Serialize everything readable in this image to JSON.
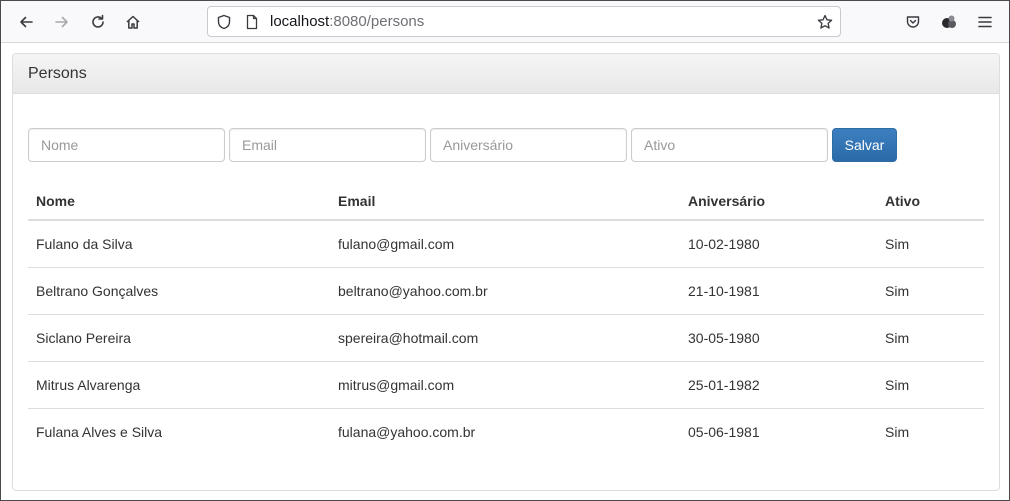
{
  "browser": {
    "url_host": "localhost",
    "url_rest": ":8080/persons",
    "icons": [
      "back-arrow-icon",
      "forward-arrow-icon",
      "reload-icon",
      "home-icon",
      "shield-icon",
      "page-icon",
      "bookmark-star-icon",
      "pocket-icon",
      "extension-icon",
      "menu-icon"
    ]
  },
  "panel": {
    "title": "Persons"
  },
  "form": {
    "nome_placeholder": "Nome",
    "email_placeholder": "Email",
    "aniversario_placeholder": "Aniversário",
    "ativo_placeholder": "Ativo",
    "save_label": "Salvar"
  },
  "table": {
    "headers": [
      "Nome",
      "Email",
      "Aniversário",
      "Ativo"
    ],
    "rows": [
      [
        "Fulano da Silva",
        "fulano@gmail.com",
        "10-02-1980",
        "Sim"
      ],
      [
        "Beltrano Gonçalves",
        "beltrano@yahoo.com.br",
        "21-10-1981",
        "Sim"
      ],
      [
        "Siclano Pereira",
        "spereira@hotmail.com",
        "30-05-1980",
        "Sim"
      ],
      [
        "Mitrus Alvarenga",
        "mitrus@gmail.com",
        "25-01-1982",
        "Sim"
      ],
      [
        "Fulana Alves e Silva",
        "fulana@yahoo.com.br",
        "05-06-1981",
        "Sim"
      ]
    ]
  },
  "colors": {
    "primary_button": "#337ab7",
    "panel_border": "#dddddd"
  }
}
